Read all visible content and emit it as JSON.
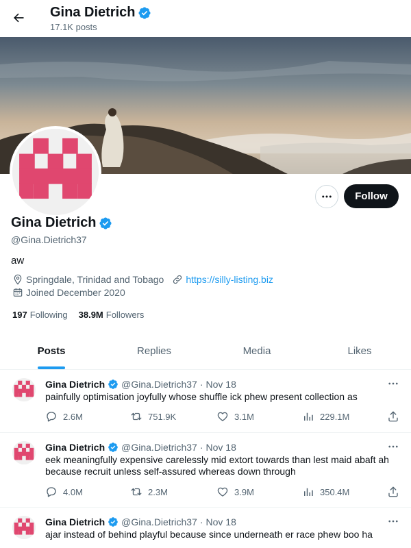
{
  "header": {
    "display_name": "Gina Dietrich",
    "post_count": "17.1K posts"
  },
  "profile": {
    "display_name": "Gina Dietrich",
    "handle": "@Gina.Dietrich37",
    "bio": "aw",
    "location": "Springdale, Trinidad and Tobago",
    "website": "https://silly-listing.biz",
    "joined": "Joined December 2020",
    "following_count": "197",
    "following_label": "Following",
    "followers_count": "38.9M",
    "followers_label": "Followers",
    "follow_button": "Follow"
  },
  "tabs": [
    {
      "label": "Posts",
      "active": true
    },
    {
      "label": "Replies",
      "active": false
    },
    {
      "label": "Media",
      "active": false
    },
    {
      "label": "Likes",
      "active": false
    }
  ],
  "posts": [
    {
      "name": "Gina Dietrich",
      "handle": "@Gina.Dietrich37",
      "separator": "·",
      "date": "Nov 18",
      "text": "painfully optimisation joyfully whose shuffle ick phew present collection as",
      "replies": "2.6M",
      "reposts": "751.9K",
      "likes": "3.1M",
      "views": "229.1M"
    },
    {
      "name": "Gina Dietrich",
      "handle": "@Gina.Dietrich37",
      "separator": "·",
      "date": "Nov 18",
      "text": "eek meaningfully expensive carelessly mid extort towards than lest maid abaft ah because recruit unless self-assured whereas down through",
      "replies": "4.0M",
      "reposts": "2.3M",
      "likes": "3.9M",
      "views": "350.4M"
    },
    {
      "name": "Gina Dietrich",
      "handle": "@Gina.Dietrich37",
      "separator": "·",
      "date": "Nov 18",
      "text": "ajar instead of behind playful because since underneath er race phew boo ha"
    }
  ],
  "colors": {
    "accent": "#1d9bf0",
    "avatar_pattern": "#e0476f",
    "follow_button_bg": "#0f1419"
  },
  "icons": [
    "back-arrow-icon",
    "verified-badge-icon",
    "more-icon",
    "location-icon",
    "link-icon",
    "calendar-icon",
    "reply-icon",
    "repost-icon",
    "like-icon",
    "views-icon",
    "share-icon"
  ]
}
